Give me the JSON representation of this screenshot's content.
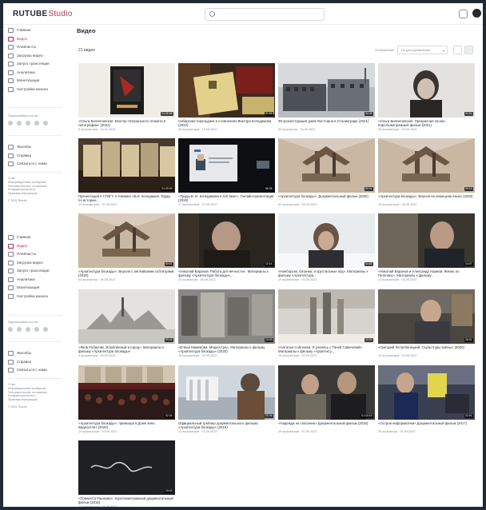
{
  "app": {
    "logo_text": "RUTUBE",
    "logo_accent": "Studio",
    "brand_color": "#e8264b"
  },
  "header": {
    "search_placeholder": ""
  },
  "sidebar": {
    "items": [
      {
        "label": "Главная",
        "icon": "home-icon"
      },
      {
        "label": "Видео",
        "icon": "video-icon",
        "active": true
      },
      {
        "label": "Плейлисты",
        "icon": "playlist-icon"
      },
      {
        "label": "Загрузка видео",
        "icon": "upload-icon"
      },
      {
        "label": "Запуск трансляции",
        "icon": "broadcast-icon"
      },
      {
        "label": "Аналитика",
        "icon": "analytics-icon"
      },
      {
        "label": "Монетизация",
        "icon": "money-icon"
      },
      {
        "label": "Настройка канала",
        "icon": "settings-icon"
      }
    ],
    "subscribe_label": "Подписывайтесь на нас",
    "help_items": [
      {
        "label": "Жалобы",
        "icon": "flag-icon"
      },
      {
        "label": "Справка",
        "icon": "help-icon"
      },
      {
        "label": "Связаться с нами",
        "icon": "chat-icon"
      }
    ],
    "legal": [
      "О нас",
      "Информационные сообщения",
      "Пользовательское соглашение",
      "Конфиденциальность",
      "Правовая информация"
    ],
    "copyright": "© 2024, Rutube"
  },
  "page": {
    "title": "Видео",
    "count": "21 видео",
    "sort_label": "Отображение",
    "sort_value": "По дате добавления"
  },
  "videos": [
    {
      "title": "«Ольга Билинтовская. Мастер театрального плаката и литографии» (2022)",
      "views": "6 просмотров",
      "date": "10.01.2023",
      "duration": "01:05:58"
    },
    {
      "title": "Сибирская геральдика в сочинениях Виктора Кочедамова (2022)",
      "views": "28 просмотров",
      "date": "13.09.2022",
      "duration": "21:53"
    },
    {
      "title": "3D-реконструкция дома Листгорна в Сталинграде (2021)",
      "views": "34 просмотра",
      "date": "13.09.2022",
      "duration": "03:08"
    },
    {
      "title": "«Ольга Билинтовская. Прекрасная эпоха». Короткометражный фильм (2021)",
      "views": "26 просмотров",
      "date": "09.09.2022",
      "duration": "22:51"
    },
    {
      "title": "Презентация в СПбГУ 4-томника «В.И. Кочедамов. Труды по истории...",
      "views": "13 просмотров",
      "date": "07.09.2022",
      "duration": "01:29:09"
    },
    {
      "title": "«Труды В. И. Кочедамова в XXI веке». Онлайн-презентация (2020)",
      "views": "17 просмотров",
      "date": "07.09.2022",
      "duration": "56:28"
    },
    {
      "title": "«Архитектура блокады». Документальный фильм (2020)",
      "views": "60 просмотров",
      "date": "06.09.2022",
      "duration": "50:01"
    },
    {
      "title": "«Архитектура блокады». Версия на немецком языке (2020)",
      "views": "19 просмотров",
      "date": "06.09.2022",
      "duration": "50:15"
    },
    {
      "title": "«Архитектура блокады». Версия с английскими субтитрами (2020)",
      "views": "64 просмотра",
      "date": "05.09.2022",
      "duration": "50:01"
    },
    {
      "title": "«Николай Баранов. Работа для вечности». Материалы к фильму «Архитектура блокады»...",
      "views": "24 просмотра",
      "date": "05.09.2022",
      "duration": "12:14"
    },
    {
      "title": "«Ниеборски, ботинки, и хрустальные ж/д». Материалы к фильму «Архитектура...",
      "views": "19 просмотров",
      "date": "03.09.2022",
      "duration": "14:52"
    },
    {
      "title": "«Николай Баранов и Александр Наумов. Жизнь по Генплану». Материалы к фильму...",
      "views": "14 просмотров",
      "date": "03.09.2022",
      "duration": "14:07"
    },
    {
      "title": "«Яков Рубанчик. Влюблённый в город». Материалы к фильму «Архитектура блокады»",
      "views": "9 просмотров",
      "date": "03.09.2022",
      "duration": "09:44"
    },
    {
      "title": "«Елена Мамикова. Медкостра». Материалы к фильму «Архитектура блокады» (2020)",
      "views": "16 просмотров",
      "date": "02.09.2022",
      "duration": "10:49"
    },
    {
      "title": "«Наталья Соболева. Я училась с Таней Савичевой». Материалы к фильму «Архитекту...",
      "views": "19 просмотров",
      "date": "02.09.2022",
      "duration": "10:01"
    },
    {
      "title": "«Григорий Ястребенецкий. Скульптуры войны» (2020)",
      "views": "13 просмотров",
      "date": "02.09.2022",
      "duration": "28:01"
    },
    {
      "title": "«Архитектура блокады»: премьера в Доме кино. Видеоотчёт (2020)",
      "views": "14 просмотров",
      "date": "02.09.2022",
      "duration": "02:24"
    },
    {
      "title": "Официальный трейлер документального фильма «Архитектура блокады» (2019)",
      "views": "12 просмотров",
      "date": "02.09.2022",
      "duration": "02:26"
    },
    {
      "title": "«Надежда на спасение» Документальный фильм (2018)",
      "views": "16 просмотров",
      "date": "01.09.2022",
      "duration": "01:10:15"
    },
    {
      "title": "«Остров информатики» Документальный фильм (2017)",
      "views": "33 просмотра",
      "date": "01.09.2022",
      "duration": "22:51"
    },
    {
      "title": "«Помнится Рашкова». Короткометражный документальный фильм (2016)",
      "views": "17 просмотров",
      "date": "01.09.2022",
      "duration": "19:03"
    }
  ]
}
